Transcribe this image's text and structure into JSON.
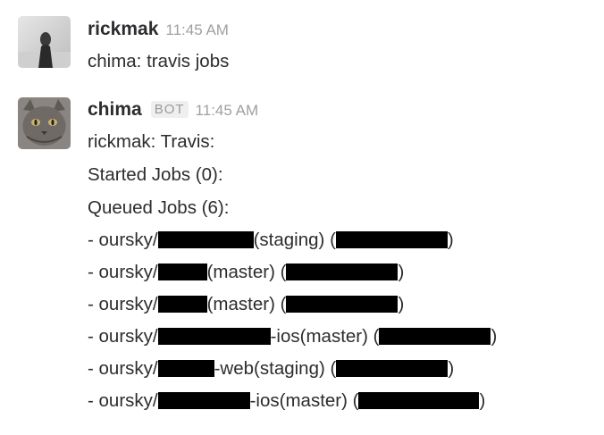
{
  "messages": [
    {
      "author": "rickmak",
      "time": "11:45 AM",
      "text": "chima: travis jobs"
    },
    {
      "author": "chima",
      "badge": "BOT",
      "time": "11:45 AM",
      "lines": {
        "header": "rickmak: Travis:",
        "started": "Started Jobs (0):",
        "queued": "Queued Jobs (6):"
      },
      "jobs": [
        {
          "prefix": "- oursky/",
          "suffix": "(staging) (",
          "end": ")"
        },
        {
          "prefix": "- oursky/",
          "suffix": "(master) (",
          "end": ")"
        },
        {
          "prefix": "- oursky/",
          "suffix": "(master) (",
          "end": ")"
        },
        {
          "prefix": "- oursky/",
          "suffix": "-ios(master) (",
          "end": ")"
        },
        {
          "prefix": "- oursky/",
          "suffix": "-web(staging) (",
          "end": ")"
        },
        {
          "prefix": "- oursky/",
          "suffix": "-ios(master) (",
          "end": ")"
        }
      ]
    }
  ],
  "colors": {
    "text": "#2c2d30",
    "timestamp": "#a0a0a2",
    "redaction": "#000000"
  }
}
